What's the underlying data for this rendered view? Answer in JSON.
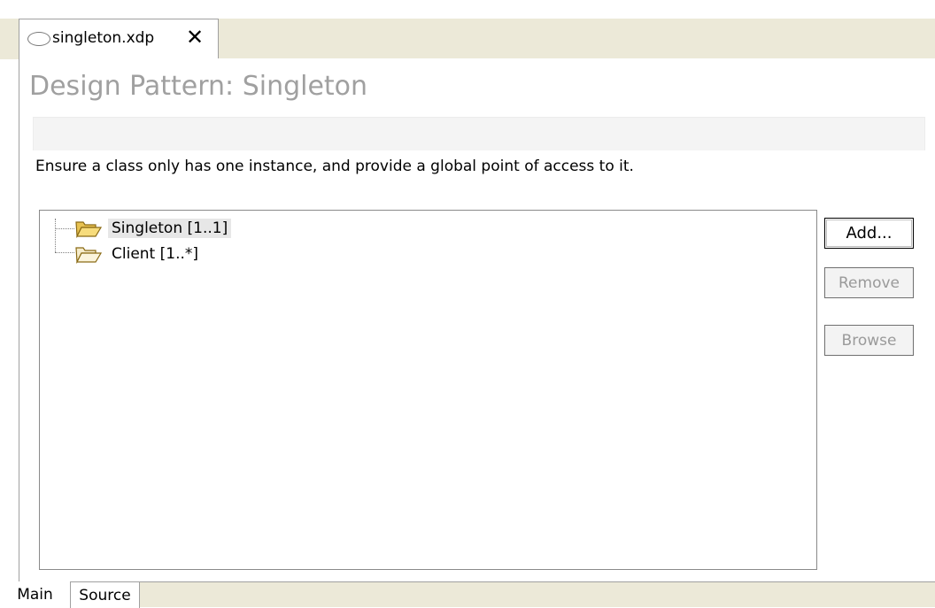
{
  "editor": {
    "tab_title": "singleton.xdp",
    "tab_icon": "file-oval-icon",
    "close_icon": "close-icon",
    "close_glyph": "✕"
  },
  "page": {
    "title": "Design Pattern: Singleton",
    "description": "Ensure a class only has one instance, and provide a global point of access to it."
  },
  "tree": {
    "items": [
      {
        "label": "Singleton [1..1]",
        "icon": "open-folder-icon",
        "selected": true
      },
      {
        "label": "Client [1..*]",
        "icon": "open-folder-icon",
        "selected": false
      }
    ]
  },
  "buttons": {
    "add": {
      "label": "Add...",
      "enabled": true
    },
    "remove": {
      "label": "Remove",
      "enabled": false
    },
    "browse": {
      "label": "Browse",
      "enabled": false
    }
  },
  "bottom_tabs": [
    {
      "label": "Main",
      "active": true
    },
    {
      "label": "Source",
      "active": false
    }
  ],
  "colors": {
    "title": "#a0a0a0",
    "chrome": "#ece9d8",
    "folder": "#f2d36b",
    "selection": "#e7e7e7"
  }
}
